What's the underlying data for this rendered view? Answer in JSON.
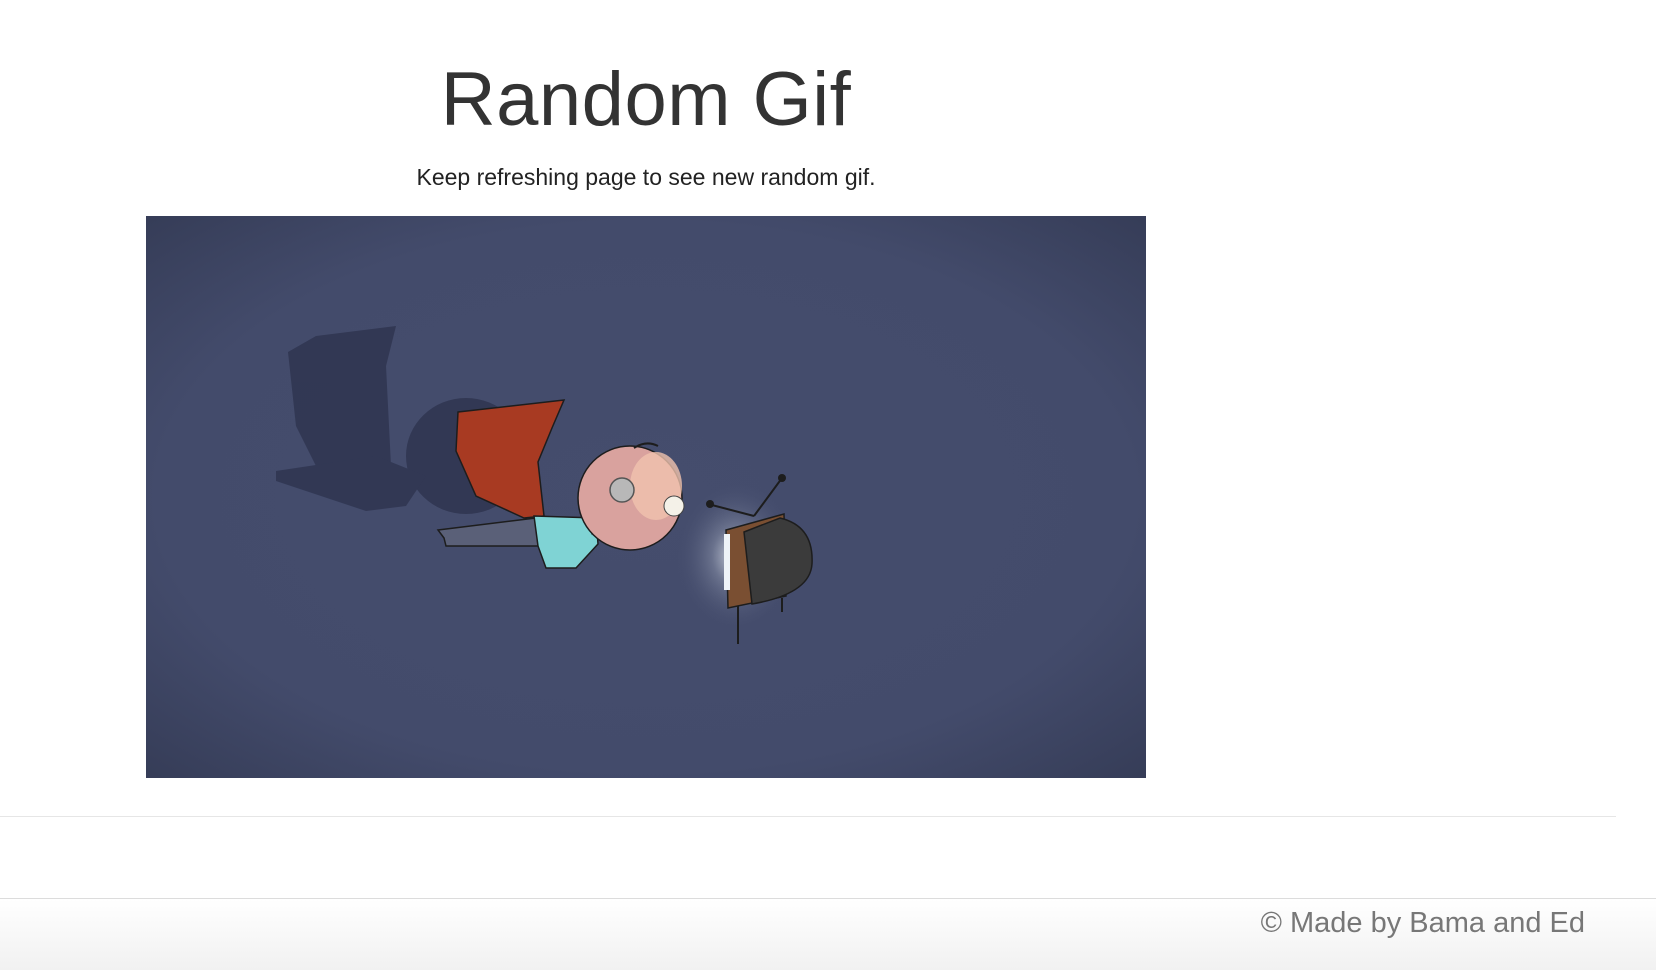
{
  "header": {
    "title": "Random Gif",
    "subtitle": "Keep refreshing page to see new random gif."
  },
  "gif": {
    "description_icon": "flying-caped-hero-tv-animation",
    "background_color": "#434b6b"
  },
  "footer": {
    "credit": "© Made by Bama and Ed"
  }
}
